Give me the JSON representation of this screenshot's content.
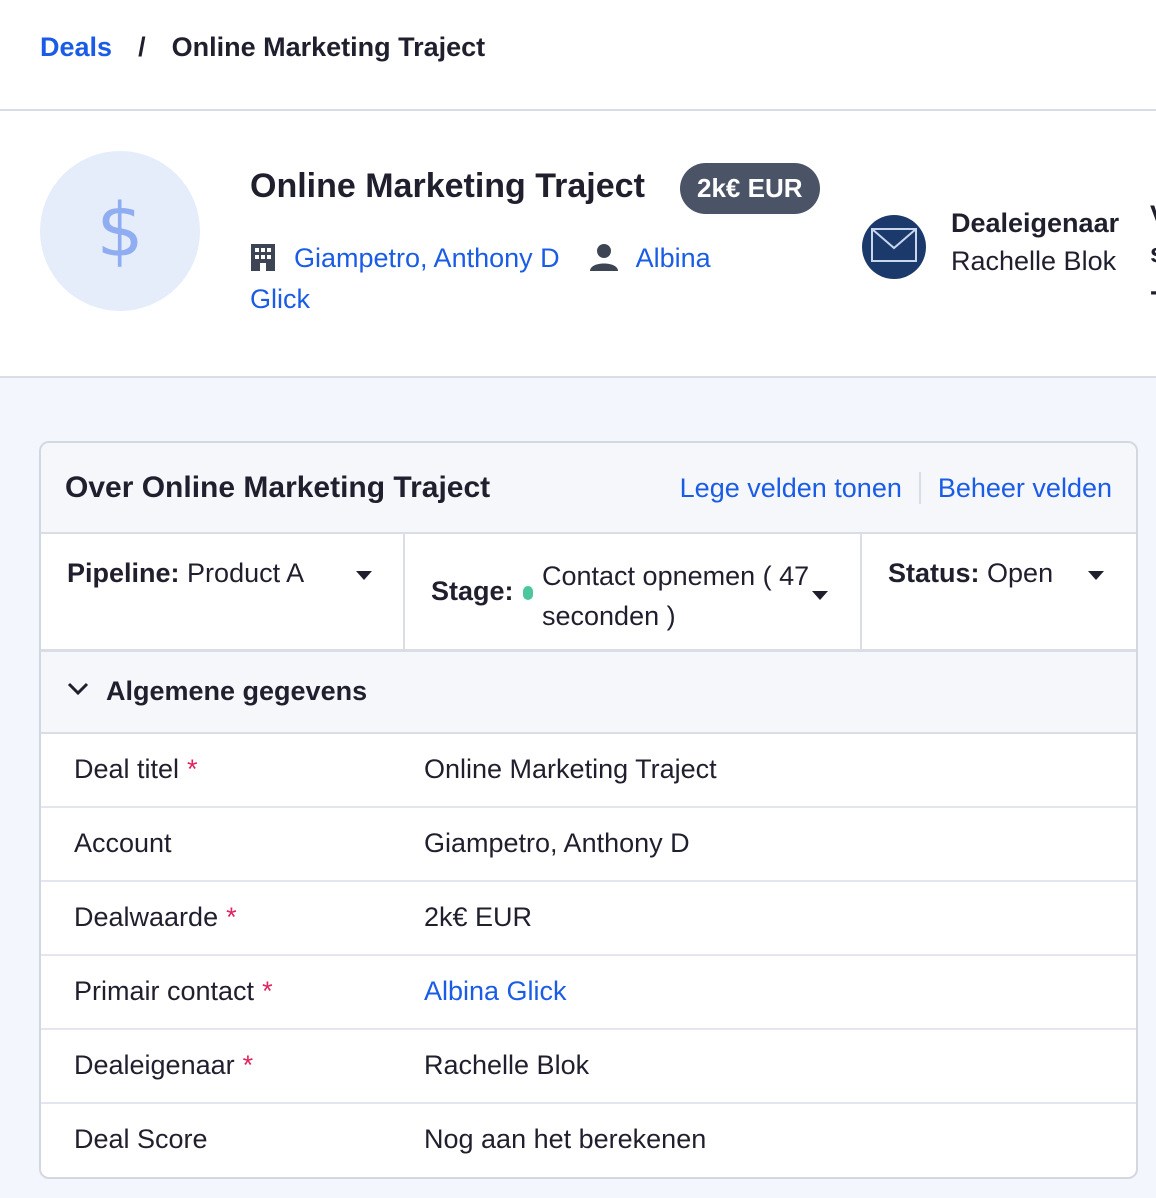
{
  "breadcrumb": {
    "root": "Deals",
    "separator": "/",
    "current": "Online Marketing Traject"
  },
  "deal": {
    "avatar_symbol": "$",
    "title": "Online Marketing Traject",
    "value_badge": "2k€ EUR",
    "account": "Giampetro, Anthony D",
    "contact_line1": "Albina",
    "contact_line2": "Glick",
    "account_icon": "building-icon",
    "contact_icon": "person-icon"
  },
  "owner": {
    "avatar_icon": "envelope-icon",
    "label": "Dealeigenaar",
    "name": "Rachelle Blok",
    "cut_label_line1": "V",
    "cut_label_line2": "s",
    "cut_label_line3": "-"
  },
  "card": {
    "title": "Over Online Marketing Traject",
    "show_empty_fields": "Lege velden tonen",
    "manage_fields": "Beheer velden"
  },
  "dropdowns": {
    "pipeline_label": "Pipeline:",
    "pipeline_value": "Product A",
    "stage_label": "Stage:",
    "stage_value": "Contact opnemen ( 47 seconden )",
    "stage_color": "#4cc79b",
    "status_label": "Status:",
    "status_value": "Open"
  },
  "section": {
    "title": "Algemene gegevens"
  },
  "fields": [
    {
      "label": "Deal titel",
      "required": "*",
      "value": "Online Marketing Traject"
    },
    {
      "label": "Account",
      "required": "",
      "value": "Giampetro, Anthony D"
    },
    {
      "label": "Dealwaarde",
      "required": "*",
      "value": "2k€ EUR"
    },
    {
      "label": "Primair contact",
      "required": "*",
      "value": "Albina Glick"
    },
    {
      "label": "Dealeigenaar",
      "required": "*",
      "value": "Rachelle Blok"
    },
    {
      "label": "Deal Score",
      "required": "",
      "value": "Nog aan het berekenen"
    }
  ],
  "colors": {
    "link": "#1a5ce5",
    "badge": "#4b5467",
    "required": "#e0245e",
    "owner_avatar": "#1b3a6b"
  }
}
